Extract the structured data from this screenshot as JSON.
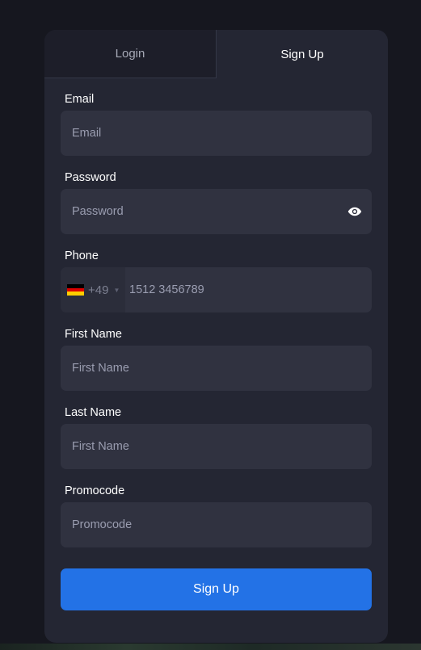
{
  "tabs": {
    "login": "Login",
    "signup": "Sign Up"
  },
  "fields": {
    "email": {
      "label": "Email",
      "placeholder": "Email"
    },
    "password": {
      "label": "Password",
      "placeholder": "Password",
      "icon": "eye-icon"
    },
    "phone": {
      "label": "Phone",
      "country_code": "+49",
      "country_flag": "germany-flag-icon",
      "placeholder": "1512 3456789"
    },
    "first_name": {
      "label": "First Name",
      "placeholder": "First Name"
    },
    "last_name": {
      "label": "Last Name",
      "placeholder": "First Name"
    },
    "promocode": {
      "label": "Promocode",
      "placeholder": "Promocode"
    }
  },
  "submit_label": "Sign Up",
  "colors": {
    "background": "#16171f",
    "card": "#242633",
    "input": "#303240",
    "accent": "#2372e6",
    "flag_black": "#000000",
    "flag_red": "#dd0000",
    "flag_gold": "#ffce00"
  }
}
